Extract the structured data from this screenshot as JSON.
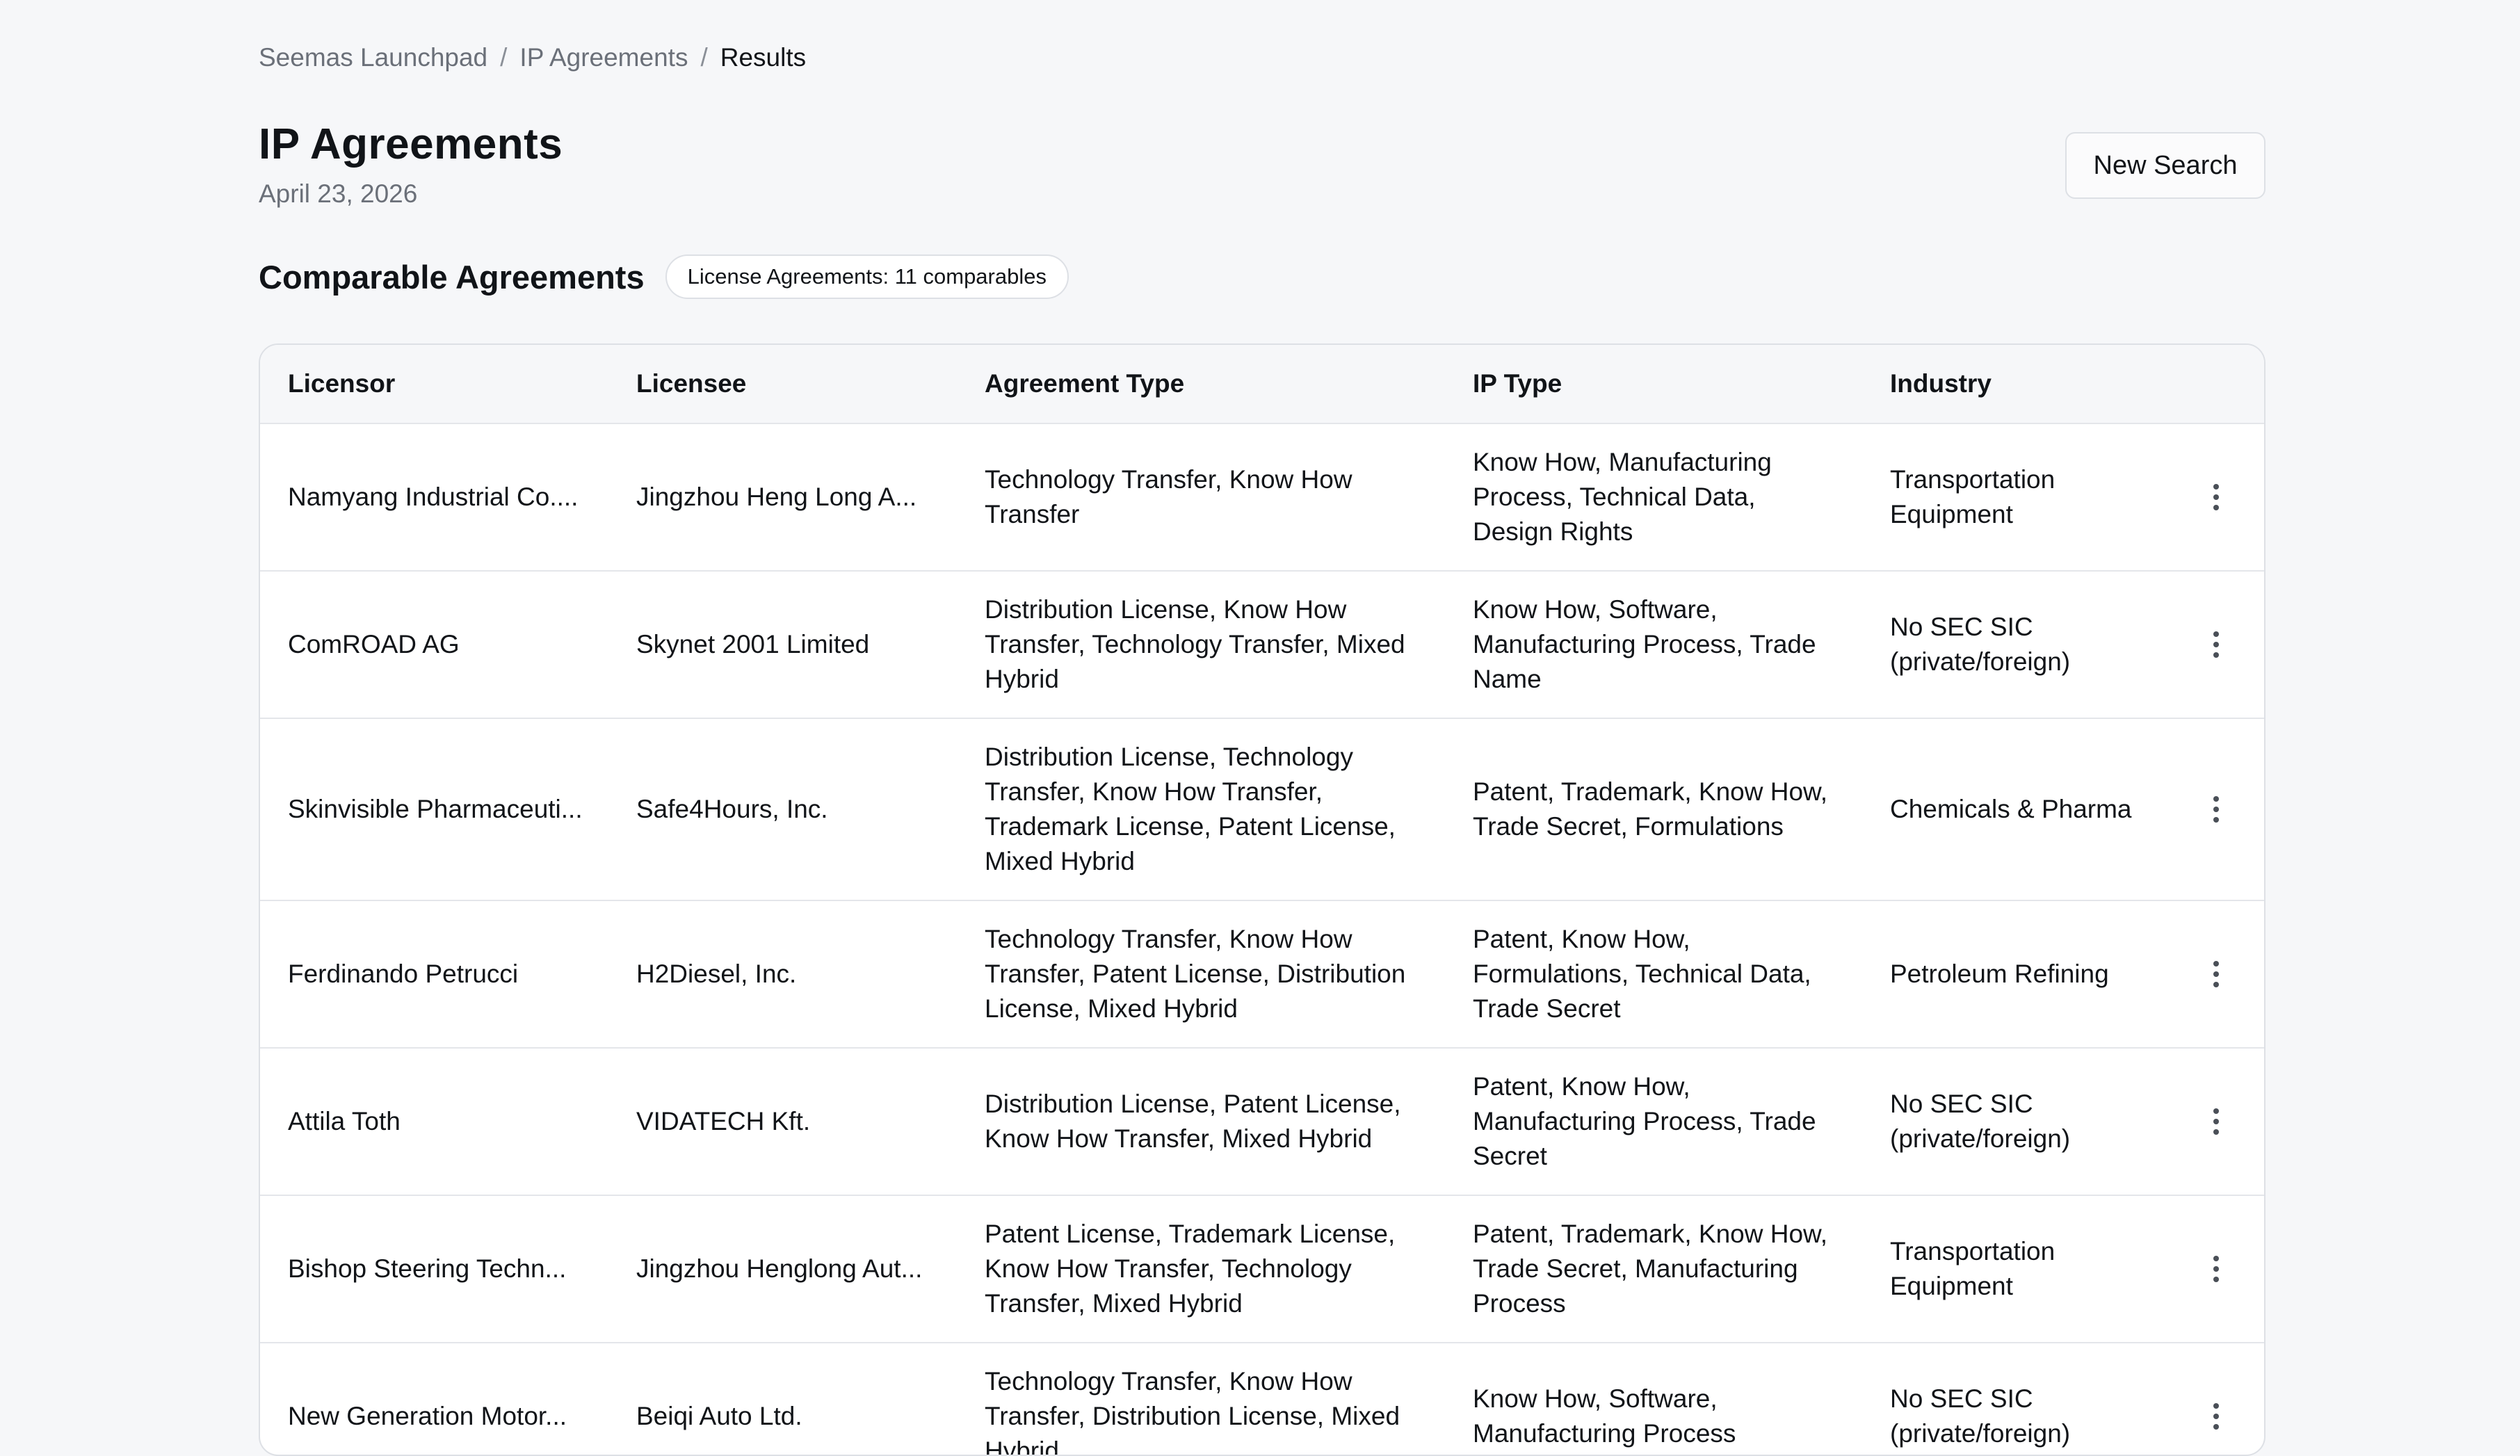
{
  "breadcrumb": {
    "items": [
      "Seemas Launchpad",
      "IP Agreements"
    ],
    "separator": "/",
    "current": "Results"
  },
  "header": {
    "title": "IP Agreements",
    "date": "April 23, 2026",
    "new_search_label": "New Search"
  },
  "section": {
    "title": "Comparable Agreements",
    "badge": "License Agreements: 11 comparables"
  },
  "table": {
    "columns": [
      "Licensor",
      "Licensee",
      "Agreement Type",
      "IP Type",
      "Industry"
    ],
    "rows": [
      {
        "licensor": "Namyang Industrial Co....",
        "licensee": "Jingzhou Heng Long A...",
        "agreement_type": "Technology Transfer, Know How Transfer",
        "ip_type": "Know How, Manufacturing Process, Technical Data, Design Rights",
        "industry": "Transportation Equipment"
      },
      {
        "licensor": "ComROAD AG",
        "licensee": "Skynet 2001 Limited",
        "agreement_type": "Distribution License, Know How Transfer, Technology Transfer, Mixed Hybrid",
        "ip_type": "Know How, Software, Manufacturing Process, Trade Name",
        "industry": "No SEC SIC (private/foreign)"
      },
      {
        "licensor": "Skinvisible Pharmaceuti...",
        "licensee": "Safe4Hours, Inc.",
        "agreement_type": "Distribution License, Technology Transfer, Know How Transfer, Trademark License, Patent License, Mixed Hybrid",
        "ip_type": "Patent, Trademark, Know How, Trade Secret, Formulations",
        "industry": "Chemicals & Pharma"
      },
      {
        "licensor": "Ferdinando Petrucci",
        "licensee": "H2Diesel, Inc.",
        "agreement_type": "Technology Transfer, Know How Transfer, Patent License, Distribution License, Mixed Hybrid",
        "ip_type": "Patent, Know How, Formulations, Technical Data, Trade Secret",
        "industry": "Petroleum Refining"
      },
      {
        "licensor": "Attila Toth",
        "licensee": "VIDATECH Kft.",
        "agreement_type": "Distribution License, Patent License, Know How Transfer, Mixed Hybrid",
        "ip_type": "Patent, Know How, Manufacturing Process, Trade Secret",
        "industry": "No SEC SIC (private/foreign)"
      },
      {
        "licensor": "Bishop Steering Techn...",
        "licensee": "Jingzhou Henglong Aut...",
        "agreement_type": "Patent License, Trademark License, Know How Transfer, Technology Transfer, Mixed Hybrid",
        "ip_type": "Patent, Trademark, Know How, Trade Secret, Manufacturing Process",
        "industry": "Transportation Equipment"
      },
      {
        "licensor": "New Generation Motor...",
        "licensee": "Beiqi Auto Ltd.",
        "agreement_type": "Technology Transfer, Know How Transfer, Distribution License, Mixed Hybrid",
        "ip_type": "Know How, Software, Manufacturing Process",
        "industry": "No SEC SIC (private/foreign)"
      }
    ],
    "row_action_icon": "more-vertical-icon"
  }
}
